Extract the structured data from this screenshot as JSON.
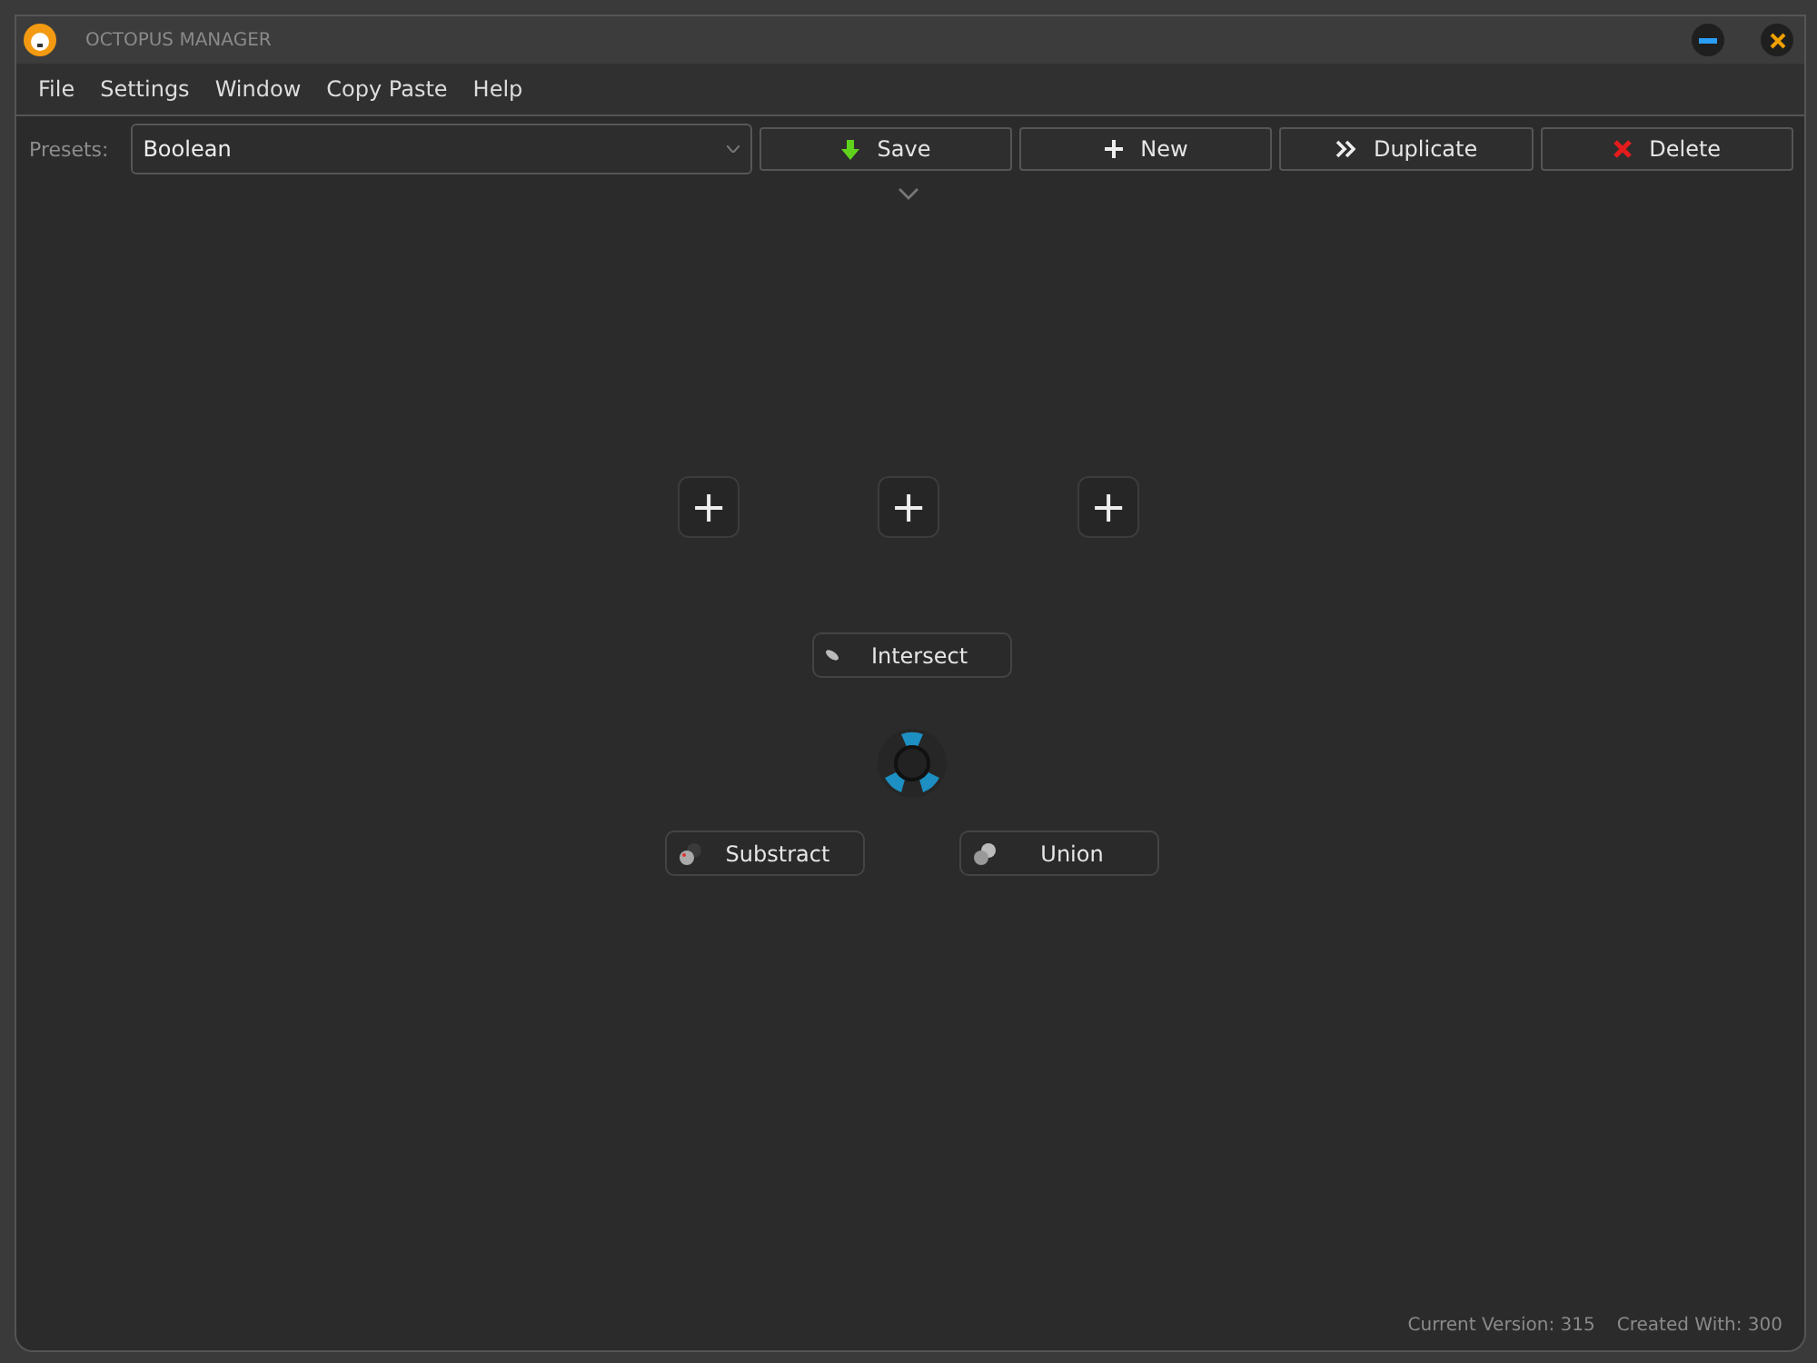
{
  "window": {
    "title": "OCTOPUS MANAGER"
  },
  "menu": [
    "File",
    "Settings",
    "Window",
    "Copy Paste",
    "Help"
  ],
  "toolbar": {
    "presets_label": "Presets:",
    "preset_value": "Boolean",
    "buttons": [
      {
        "label": "Save",
        "kind": "save"
      },
      {
        "label": "New",
        "kind": "new"
      },
      {
        "label": "Duplicate",
        "kind": "duplicate"
      },
      {
        "label": "Delete",
        "kind": "delete"
      }
    ]
  },
  "pie_menu": {
    "add_slots": [
      "+",
      "+",
      "+"
    ],
    "options": [
      {
        "label": "Intersect",
        "kind": "intersect"
      },
      {
        "label": "Substract",
        "kind": "subtract"
      },
      {
        "label": "Union",
        "kind": "union"
      }
    ]
  },
  "status_bar": {
    "current_version": "Current Version: 315",
    "created_with": "Created With: 300"
  }
}
